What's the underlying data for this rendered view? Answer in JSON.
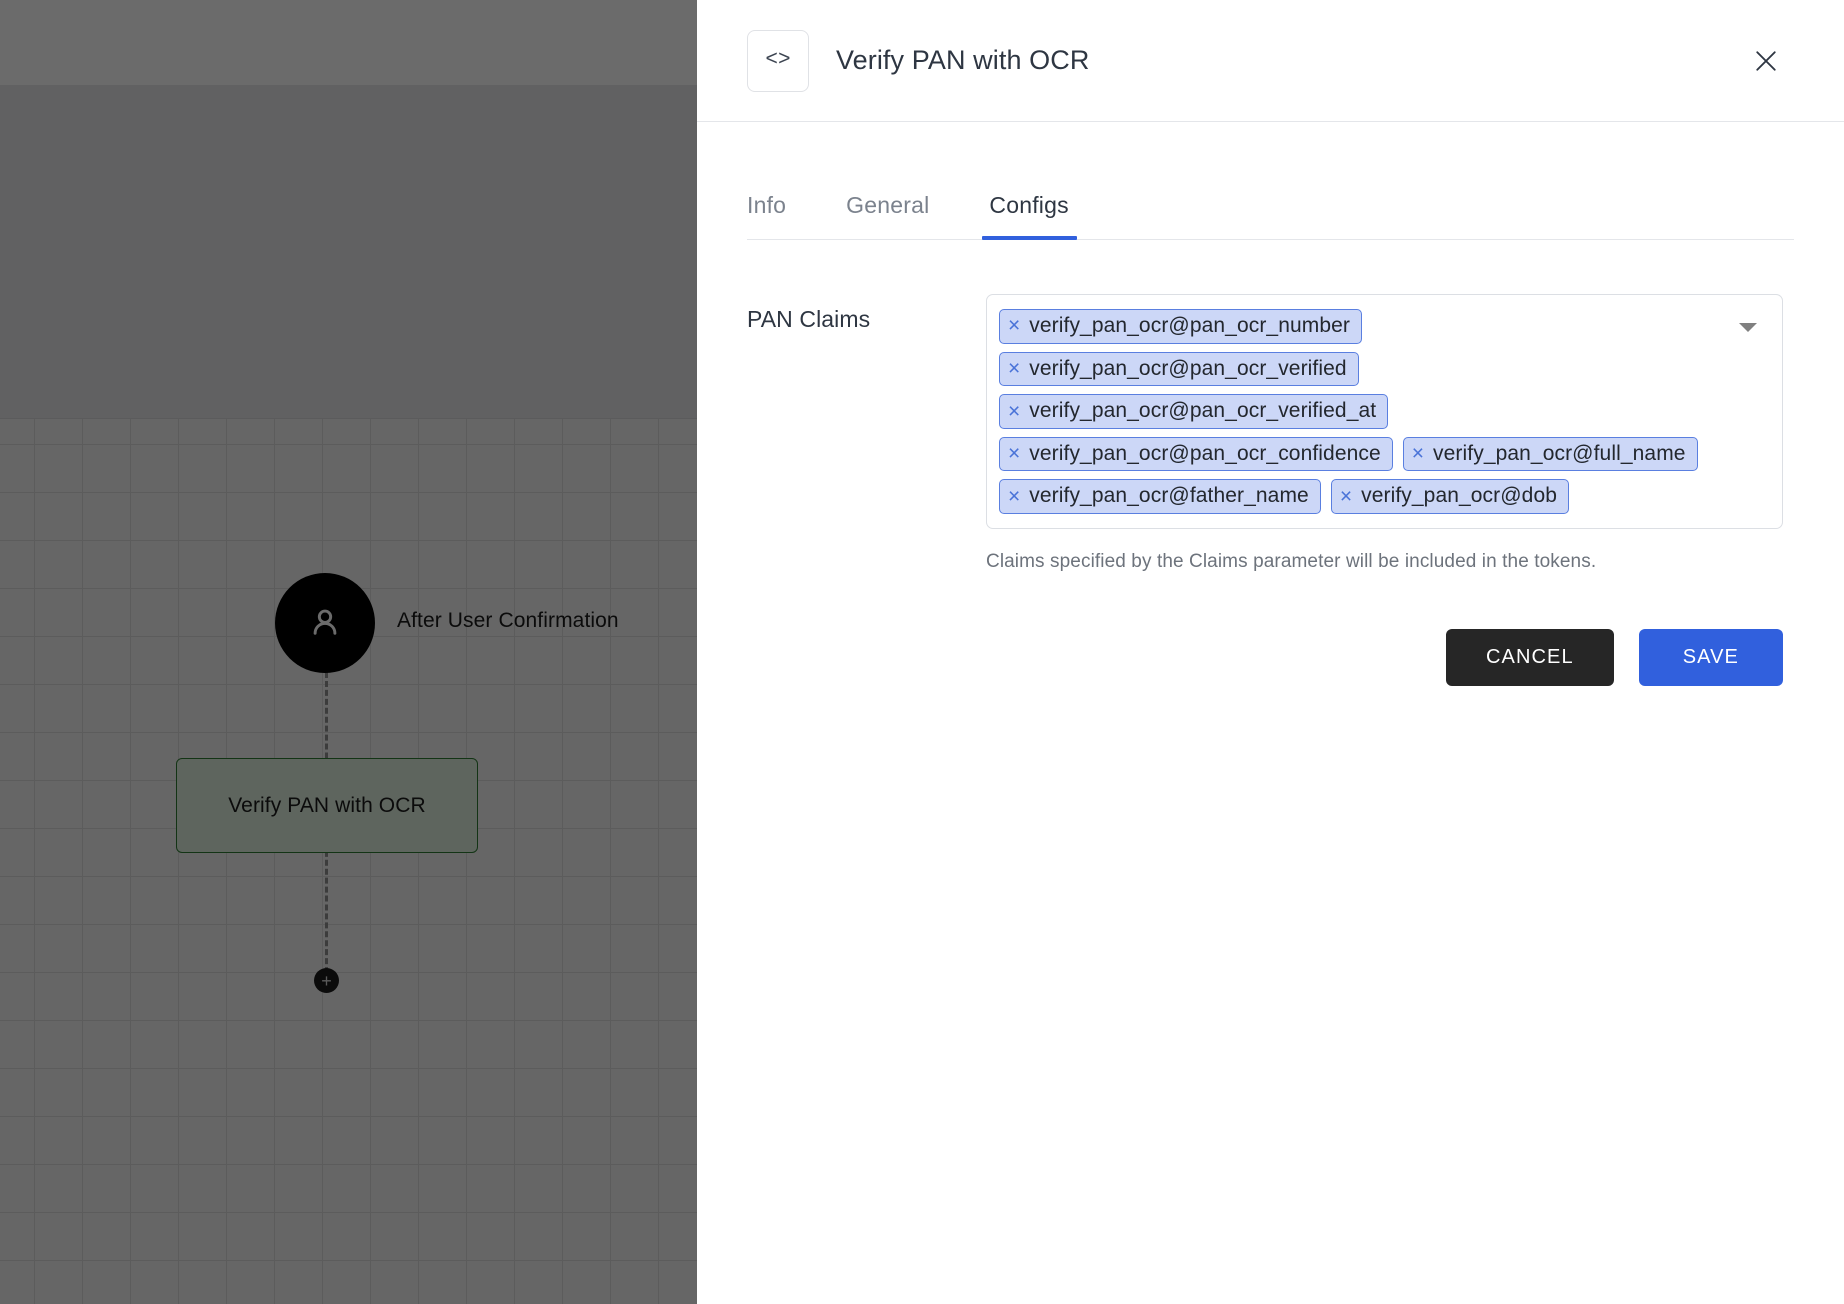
{
  "canvas": {
    "trigger_label": "After User Confirmation",
    "node_label": "Verify PAN with OCR",
    "add_button_label": "+",
    "user_icon": "person-icon"
  },
  "drawer": {
    "header": {
      "icon": "<>",
      "icon_name": "code-icon",
      "title": "Verify PAN with OCR",
      "close_label": "✕"
    },
    "tabs": [
      {
        "label": "Info",
        "active": false
      },
      {
        "label": "General",
        "active": false
      },
      {
        "label": "Configs",
        "active": true
      }
    ],
    "field": {
      "label": "PAN Claims",
      "helper": "Claims specified by the Claims parameter will be included in the tokens.",
      "remove_glyph": "×",
      "dropdown_icon": "chevron-down-icon",
      "chips": [
        "verify_pan_ocr@pan_ocr_number",
        "verify_pan_ocr@pan_ocr_verified",
        "verify_pan_ocr@pan_ocr_verified_at",
        "verify_pan_ocr@pan_ocr_confidence",
        "verify_pan_ocr@full_name",
        "verify_pan_ocr@father_name",
        "verify_pan_ocr@dob"
      ]
    },
    "actions": {
      "cancel_label": "CANCEL",
      "save_label": "SAVE"
    }
  },
  "colors": {
    "accent_blue": "#3160dd",
    "chip_bg": "#ccd7f7",
    "chip_border": "#5a7fe0",
    "cancel_bg": "#262626",
    "node_green_bg": "#dff0df",
    "node_green_border": "#2f7d32"
  }
}
